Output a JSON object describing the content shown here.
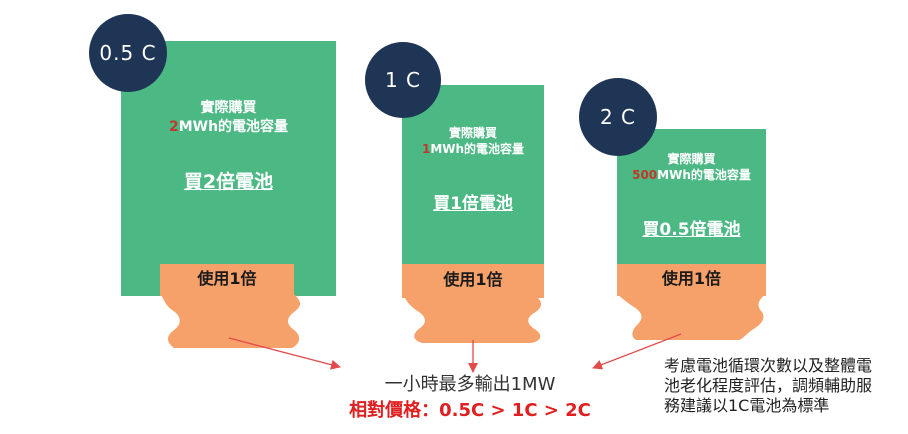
{
  "colors": {
    "panel_green": "#4cb884",
    "usage_orange": "#f6a06a",
    "badge_navy": "#1f3556",
    "highlight_red": "#c0392b",
    "price_red": "#e02020",
    "arrow_red": "#e24b4b"
  },
  "cards": [
    {
      "rate": "0.5 C",
      "bought_label": "實際購買",
      "capacity_num": "2",
      "capacity_unit": "MWh的電池容量",
      "buy_label": "買2倍電池",
      "use_label": "使用1倍"
    },
    {
      "rate": "1 C",
      "bought_label": "實際購買",
      "capacity_num": "1",
      "capacity_unit": "MWh的電池容量",
      "buy_label": "買1倍電池",
      "use_label": "使用1倍"
    },
    {
      "rate": "2 C",
      "bought_label": "實際購買",
      "capacity_num": "500",
      "capacity_unit": "MWh的電池容量",
      "buy_label": "買0.5倍電池",
      "use_label": "使用1倍"
    }
  ],
  "output_caption": "一小時最多輸出1MW",
  "price_caption": "相對價格：0.5C > 1C > 2C",
  "note": {
    "line1": "考慮電池循環次數以及整體電",
    "line2": "池老化程度評估，調頻輔助服",
    "line3": "務建議以1C電池為標準"
  }
}
